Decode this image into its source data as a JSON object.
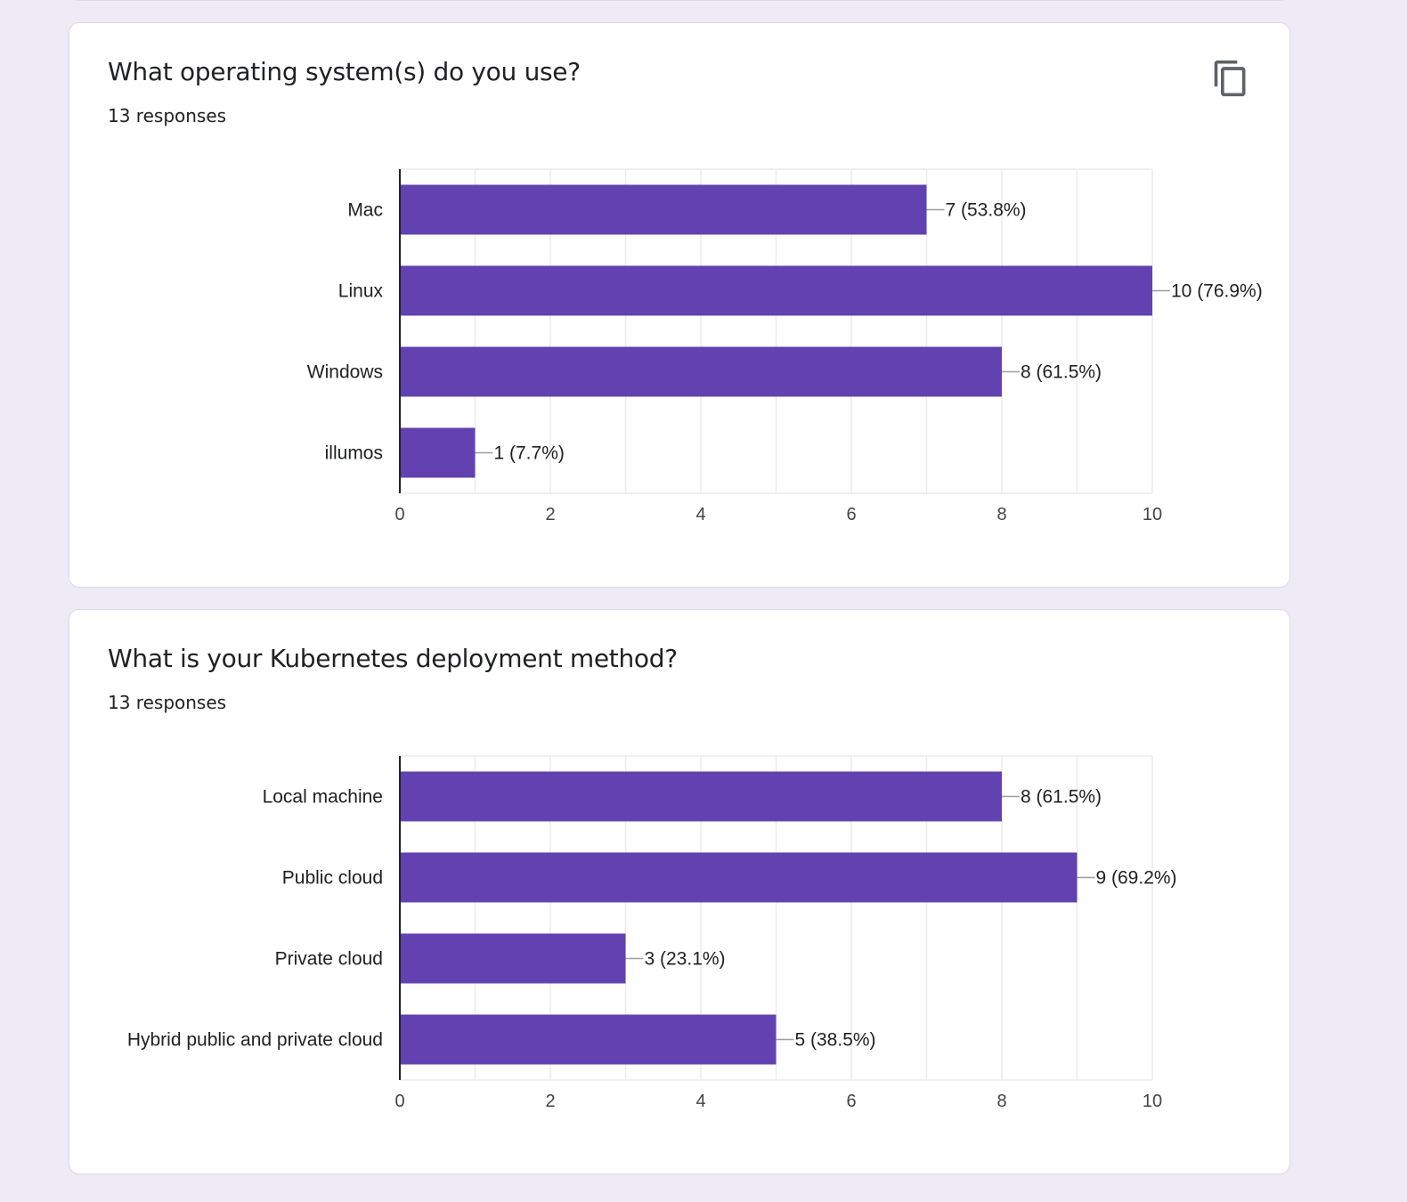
{
  "colors": {
    "bar": "#6241b0",
    "grid": "#ececec",
    "axis": "#202124",
    "leader": "#9e9e9e"
  },
  "icons": {
    "copy": "copy-icon"
  },
  "questions": [
    {
      "title": "What operating system(s) do you use?",
      "responses": "13 responses",
      "show_copy": true
    },
    {
      "title": "What is your Kubernetes deployment method?",
      "responses": "13 responses",
      "show_copy": false
    }
  ],
  "chart_data": [
    {
      "type": "bar",
      "orientation": "horizontal",
      "categories": [
        "Mac",
        "Linux",
        "Windows",
        "illumos"
      ],
      "values": [
        7,
        10,
        8,
        1
      ],
      "data_labels": [
        "7 (53.8%)",
        "10 (76.9%)",
        "8 (61.5%)",
        "1 (7.7%)"
      ],
      "xlim": [
        0,
        10
      ],
      "xticks": [
        0,
        2,
        4,
        6,
        8,
        10
      ],
      "grid": true
    },
    {
      "type": "bar",
      "orientation": "horizontal",
      "categories": [
        "Local machine",
        "Public cloud",
        "Private cloud",
        "Hybrid public and private cloud"
      ],
      "values": [
        8,
        9,
        3,
        5
      ],
      "data_labels": [
        "8 (61.5%)",
        "9 (69.2%)",
        "3 (23.1%)",
        "5 (38.5%)"
      ],
      "xlim": [
        0,
        10
      ],
      "xticks": [
        0,
        2,
        4,
        6,
        8,
        10
      ],
      "grid": true
    }
  ]
}
